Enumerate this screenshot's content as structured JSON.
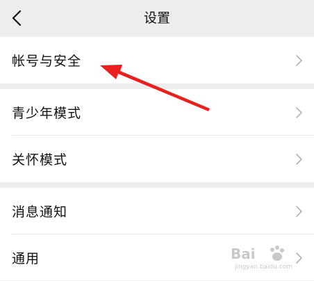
{
  "header": {
    "title": "设置",
    "back_icon": "back-chevron-icon"
  },
  "groups": [
    {
      "items": [
        {
          "label": "帐号与安全"
        }
      ]
    },
    {
      "items": [
        {
          "label": "青少年模式"
        },
        {
          "label": "关怀模式"
        }
      ]
    },
    {
      "items": [
        {
          "label": "消息通知"
        },
        {
          "label": "通用"
        }
      ]
    }
  ],
  "annotation": {
    "color": "#e8211f"
  },
  "watermark": {
    "brand": "Bai",
    "sub": "jingyan.baidu.com"
  }
}
